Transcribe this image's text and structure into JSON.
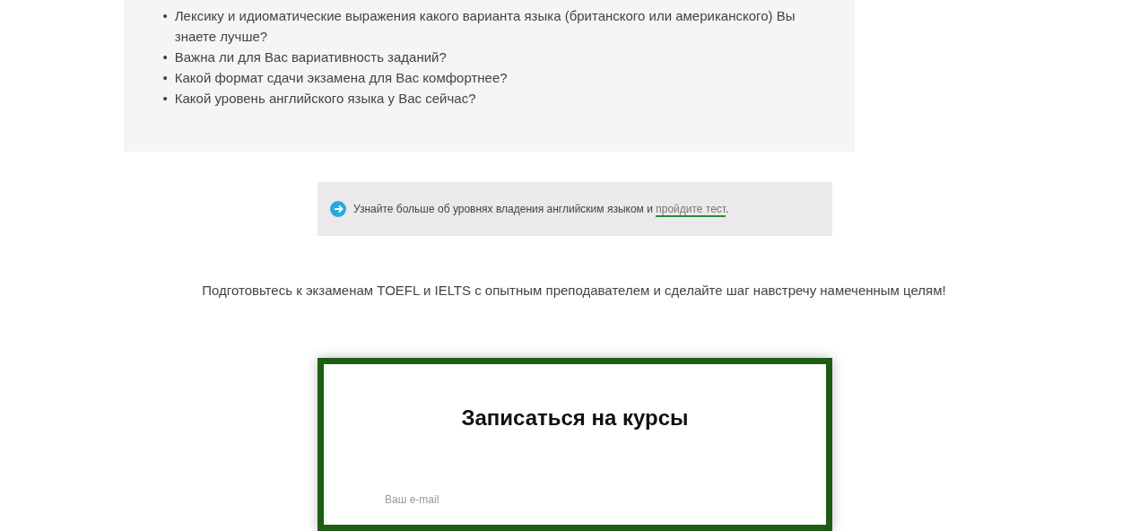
{
  "questions": [
    {
      "marker": "•",
      "text": "Лексику и идиоматические выражения какого варианта языка (британского или американского) Вы знаете лучше?"
    },
    {
      "marker": "•",
      "text": "Важна ли для Вас вариативность заданий?"
    },
    {
      "marker": "•",
      "text": "Какой формат сдачи экзамена для Вас комфортнее?"
    },
    {
      "marker": "•",
      "text": "Какой уровень английского языка у Вас сейчас?"
    }
  ],
  "info": {
    "text": "Узнайте больше об уровнях владения английским языком и ",
    "link": "пройдите тест",
    "after": "."
  },
  "cta": "Подготовьтесь к экзаменам TOEFL и IELTS с опытным преподавателем и сделайте шаг навстречу намеченным целям!",
  "form": {
    "title": "Записаться на курсы",
    "email_label": "Ваш e-mail"
  }
}
